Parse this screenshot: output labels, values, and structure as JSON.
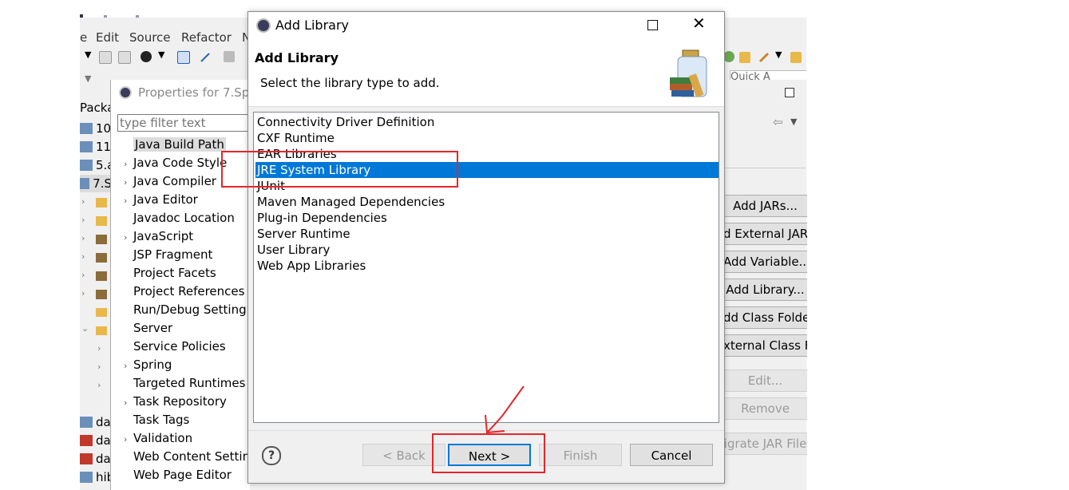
{
  "background": {
    "menu": [
      "e",
      "Edit",
      "Source",
      "Refactor",
      "N"
    ],
    "package_explorer_label": "Packa",
    "package_items": [
      "10",
      "11",
      "5.a",
      "7.S"
    ],
    "lower_items": [
      "da",
      "da",
      "da",
      "hib"
    ],
    "quick_access": "Quick A",
    "right_buttons": [
      {
        "label": "Add JARs...",
        "enabled": true
      },
      {
        "label": "d External JAR",
        "enabled": true
      },
      {
        "label": "Add Variable...",
        "enabled": true
      },
      {
        "label": "Add Library...",
        "enabled": true
      },
      {
        "label": "dd Class Folder",
        "enabled": true
      },
      {
        "label": "xternal Class Fo",
        "enabled": true
      },
      {
        "label": "Edit...",
        "enabled": false
      },
      {
        "label": "Remove",
        "enabled": false
      },
      {
        "label": "igrate JAR File",
        "enabled": false
      }
    ]
  },
  "properties_dialog": {
    "title": "Properties for 7.Sp",
    "filter_placeholder": "type filter text",
    "items": [
      {
        "label": "Java Build Path",
        "expandable": false,
        "selected": true
      },
      {
        "label": "Java Code Style",
        "expandable": true
      },
      {
        "label": "Java Compiler",
        "expandable": true
      },
      {
        "label": "Java Editor",
        "expandable": true
      },
      {
        "label": "Javadoc Location",
        "expandable": false
      },
      {
        "label": "JavaScript",
        "expandable": true
      },
      {
        "label": "JSP Fragment",
        "expandable": false
      },
      {
        "label": "Project Facets",
        "expandable": false
      },
      {
        "label": "Project References",
        "expandable": false
      },
      {
        "label": "Run/Debug Setting",
        "expandable": false
      },
      {
        "label": "Server",
        "expandable": false
      },
      {
        "label": "Service Policies",
        "expandable": false
      },
      {
        "label": "Spring",
        "expandable": true
      },
      {
        "label": "Targeted Runtimes",
        "expandable": false
      },
      {
        "label": "Task Repository",
        "expandable": true
      },
      {
        "label": "Task Tags",
        "expandable": false
      },
      {
        "label": "Validation",
        "expandable": true
      },
      {
        "label": "Web Content Settin",
        "expandable": false
      },
      {
        "label": "Web Page Editor",
        "expandable": false
      }
    ]
  },
  "add_library_dialog": {
    "window_title": "Add Library",
    "heading": "Add Library",
    "description": "Select the library type to add.",
    "libraries": [
      "Connectivity Driver Definition",
      "CXF Runtime",
      "EAR Libraries",
      "JRE System Library",
      "JUnit",
      "Maven Managed Dependencies",
      "Plug-in Dependencies",
      "Server Runtime",
      "User Library",
      "Web App Libraries"
    ],
    "selected_library": "JRE System Library",
    "buttons": {
      "back": "< Back",
      "next": "Next >",
      "finish": "Finish",
      "cancel": "Cancel"
    },
    "help_icon": "question-mark-icon",
    "close_icon": "close-icon",
    "maximize_icon": "maximize-icon"
  },
  "colors": {
    "selection": "#0078d7",
    "annotation": "#e5252b"
  }
}
